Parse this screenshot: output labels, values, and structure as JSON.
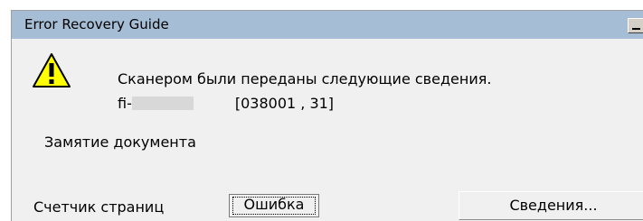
{
  "window": {
    "title": "Error Recovery Guide"
  },
  "message": {
    "line1": "Сканером были переданы следующие сведения.",
    "model_prefix": "fi-",
    "code": "[038001 , 31]",
    "description": "Замятие документа"
  },
  "footer": {
    "page_counter_label": "Счетчик страниц",
    "error_tab_label": "Ошибка",
    "details_button_label": "Сведения..."
  },
  "icons": {
    "warning": "warning-icon",
    "minimize": "minimize-icon"
  },
  "colors": {
    "titlebar": "#a5bdd5",
    "window_bg": "#f0f0f0",
    "warning_yellow": "#ffff00"
  }
}
